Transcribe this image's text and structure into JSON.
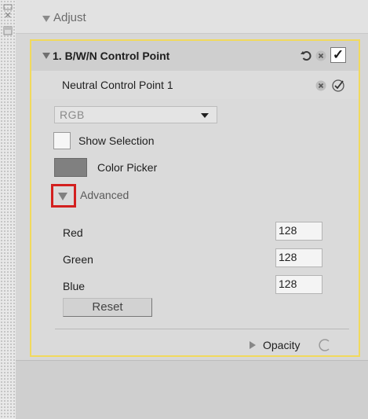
{
  "adjust": {
    "title": "Adjust"
  },
  "control_point": {
    "title": "1. B/W/N Control Point",
    "checkmark": "✓",
    "neutral": {
      "title": "Neutral Control Point 1",
      "mode_select": {
        "value": "RGB",
        "options": [
          "RGB"
        ]
      },
      "show_selection": {
        "label": "Show Selection",
        "checked": false
      },
      "color_picker": {
        "label": "Color Picker",
        "swatch_color": "#808080"
      },
      "advanced": {
        "label": "Advanced",
        "params": [
          {
            "label": "Red",
            "value": "128"
          },
          {
            "label": "Green",
            "value": "128"
          },
          {
            "label": "Blue",
            "value": "128"
          }
        ],
        "reset_label": "Reset"
      },
      "opacity_label": "Opacity"
    }
  },
  "colors": {
    "highlight_border": "#f1d95d",
    "annotation_red": "#d3201f"
  }
}
